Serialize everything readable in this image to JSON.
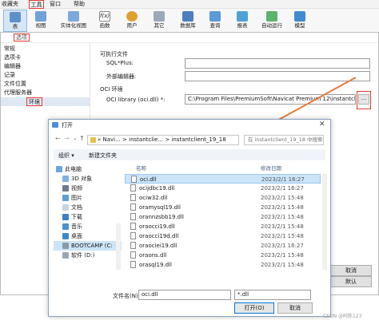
{
  "menubar": {
    "items": [
      "收藏夹",
      "工具",
      "窗口",
      "帮助"
    ]
  },
  "ribbon": {
    "buttons": [
      "表",
      "视图",
      "实体化视图",
      "函数",
      "用户",
      "其它",
      "数据库",
      "查询",
      "报表",
      "自动运行",
      "模型"
    ]
  },
  "options_window": {
    "title": "选项",
    "nav_items": [
      "常规",
      "选项卡",
      "编辑器",
      "记录",
      "文件位置",
      "代理服务器",
      "环境"
    ],
    "selected_nav": "环境",
    "section_exec": "可执行文件",
    "sqlplus_label": "SQL*Plus:",
    "ext_editor_label": "外部编辑器:",
    "oci_section": "OCI 环境",
    "oci_label": "OCI library (oci.dll) *:",
    "oci_value": "C:\\Program Files\\PremiumSoft\\Navicat Premium 12\\instantcli",
    "browse_label": "...",
    "cancel_label": "取消",
    "default_label": "默认"
  },
  "open_dialog": {
    "title": "打开",
    "path_segments": [
      "«  Navi...",
      "instantclie...",
      "instantclient_19_18"
    ],
    "search_placeholder": "在 instantclient_19_18 中搜索",
    "organize_label": "组织 ▾",
    "new_folder_label": "新建文件夹",
    "tree": [
      "此电脑",
      "3D 对象",
      "视频",
      "图片",
      "文档",
      "下载",
      "音乐",
      "桌面",
      "BOOTCAMP (C:",
      "软件 (D:)"
    ],
    "col_name": "名称",
    "col_date": "修改日期",
    "files": [
      {
        "name": "oci.dll",
        "date": "2023/2/1 16:27"
      },
      {
        "name": "ocijdbc19.dll",
        "date": "2023/2/1 16:27"
      },
      {
        "name": "ociw32.dll",
        "date": "2023/2/1 15:48"
      },
      {
        "name": "oramysql19.dll",
        "date": "2023/2/1 15:48"
      },
      {
        "name": "orannzsbb19.dll",
        "date": "2023/2/1 15:48"
      },
      {
        "name": "oraocci19.dll",
        "date": "2023/2/1 15:48"
      },
      {
        "name": "oraocci19d.dll",
        "date": "2023/2/1 15:48"
      },
      {
        "name": "oraociei19.dll",
        "date": "2023/2/1 16:27"
      },
      {
        "name": "oraons.dll",
        "date": "2023/2/1 15:48"
      },
      {
        "name": "orasql19.dll",
        "date": "2023/2/1 15:48"
      }
    ],
    "filename_label": "文件名(N):",
    "filename_value": "oci.dll",
    "filter_value": "*.dll",
    "open_label": "打开(O)",
    "cancel_label": "取消"
  },
  "watermark": "CSDN @阿陈123"
}
